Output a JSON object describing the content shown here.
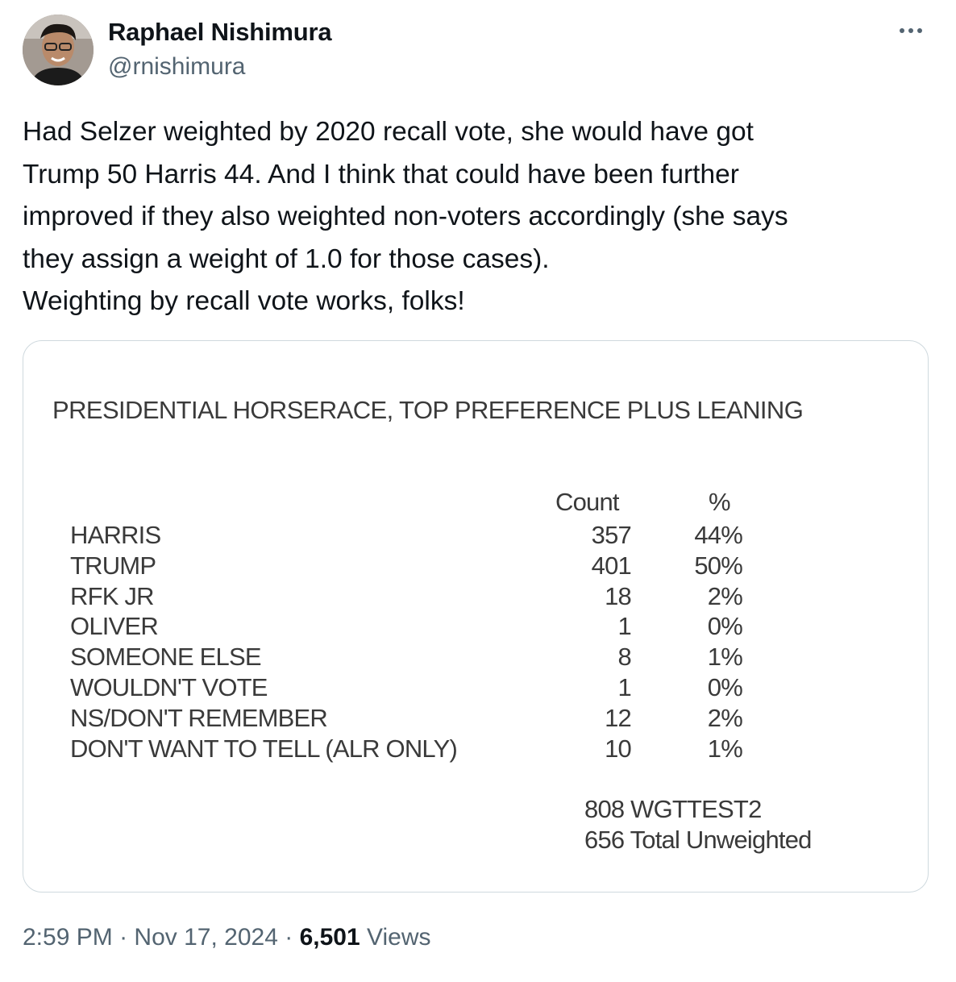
{
  "author": {
    "display_name": "Raphael Nishimura",
    "handle": "@rnishimura"
  },
  "tweet": {
    "lines": [
      "Had Selzer weighted by 2020 recall vote, she would have got",
      "Trump 50 Harris 44. And I think that could have been further",
      "improved if they also weighted non-voters accordingly (she says",
      "they assign a weight of 1.0 for those cases).",
      "Weighting by recall vote works, folks!"
    ]
  },
  "media": {
    "title": "PRESIDENTIAL HORSERACE, TOP PREFERENCE PLUS LEANING",
    "columns": {
      "count": "Count",
      "pct": "%"
    },
    "rows": [
      {
        "label": "HARRIS",
        "count": "357",
        "pct": "44%"
      },
      {
        "label": "TRUMP",
        "count": "401",
        "pct": "50%"
      },
      {
        "label": "RFK JR",
        "count": "18",
        "pct": "2%"
      },
      {
        "label": "OLIVER",
        "count": "1",
        "pct": "0%"
      },
      {
        "label": "SOMEONE ELSE",
        "count": "8",
        "pct": "1%"
      },
      {
        "label": "WOULDN'T VOTE",
        "count": "1",
        "pct": "0%"
      },
      {
        "label": "NS/DON'T REMEMBER",
        "count": "12",
        "pct": "2%"
      },
      {
        "label": "DON'T WANT TO TELL (ALR ONLY)",
        "count": "10",
        "pct": "1%"
      }
    ],
    "footer": [
      "808 WGTTEST2",
      "656 Total Unweighted"
    ]
  },
  "meta": {
    "time": "2:59 PM",
    "separator": "·",
    "date": "Nov 17, 2024",
    "views_count": "6,501",
    "views_label": "Views"
  },
  "colors": {
    "text_primary": "#0f1419",
    "text_secondary": "#536471",
    "card_border": "#cfd9de"
  },
  "icons": {
    "more": "more-horizontal-icon"
  }
}
